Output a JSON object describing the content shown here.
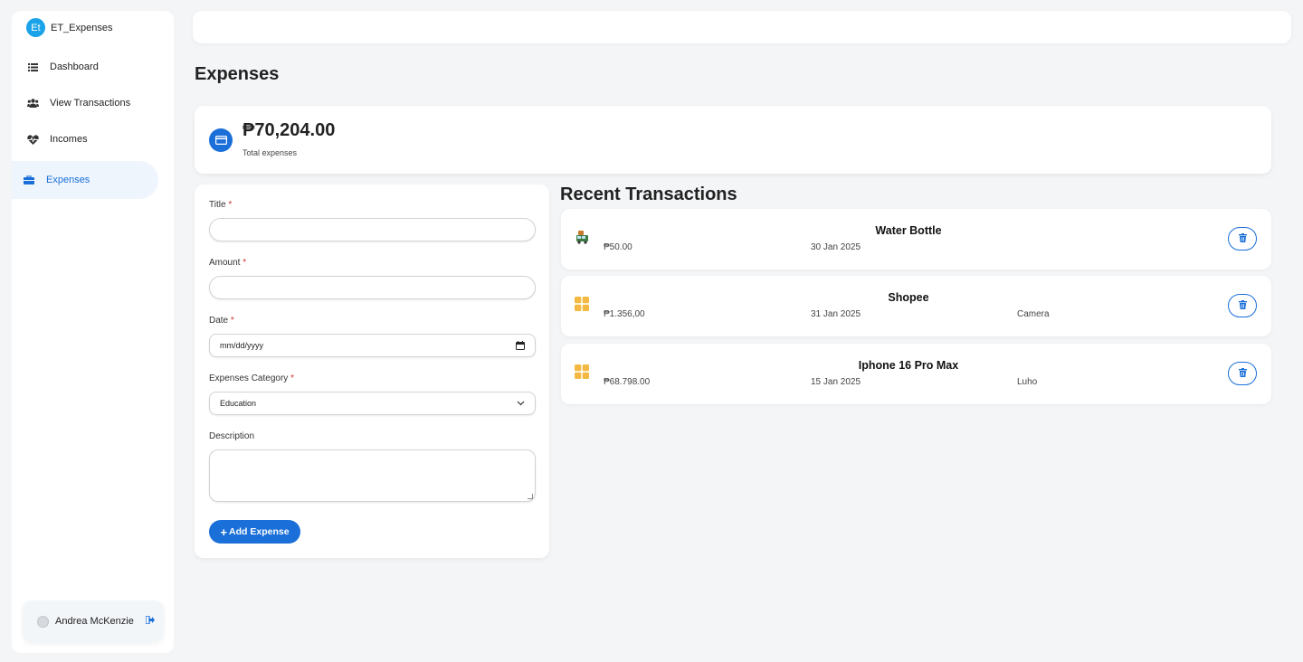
{
  "brand": {
    "logo_text": "Et",
    "name": "ET_Expenses"
  },
  "sidebar": {
    "items": [
      {
        "label": "Dashboard",
        "icon": "list-icon"
      },
      {
        "label": "View Transactions",
        "icon": "users-icon"
      },
      {
        "label": "Incomes",
        "icon": "heartbeat-icon"
      },
      {
        "label": "Expenses",
        "icon": "briefcase-icon",
        "active": true
      }
    ],
    "user": {
      "name": "Andrea McKenzie"
    }
  },
  "page": {
    "title": "Expenses"
  },
  "summary": {
    "amount": "₱70,204.00",
    "label": "Total expenses"
  },
  "form": {
    "title_label": "Title",
    "amount_label": "Amount",
    "date_label": "Date",
    "date_placeholder": "mm/dd/yyyy",
    "category_label": "Expenses Category",
    "category_value": "Education",
    "description_label": "Description",
    "required_mark": "*",
    "submit_icon": "+",
    "submit_label": "Add Expense"
  },
  "recent": {
    "title": "Recent Transactions",
    "items": [
      {
        "title": "Water Bottle",
        "amount": "₱50.00",
        "date": "30 Jan 2025",
        "description": "",
        "icon": "bus-icon"
      },
      {
        "title": "Shopee",
        "amount": "₱1.356,00",
        "date": "31 Jan 2025",
        "description": "Camera",
        "icon": "grid-icon"
      },
      {
        "title": "Iphone 16 Pro Max",
        "amount": "₱68.798.00",
        "date": "15 Jan 2025",
        "description": "Luho",
        "icon": "grid-icon"
      }
    ]
  },
  "colors": {
    "accent": "#1a6fd8",
    "brand": "#1aa3e8",
    "required": "#d32f2f",
    "background": "#f3f5f7"
  }
}
